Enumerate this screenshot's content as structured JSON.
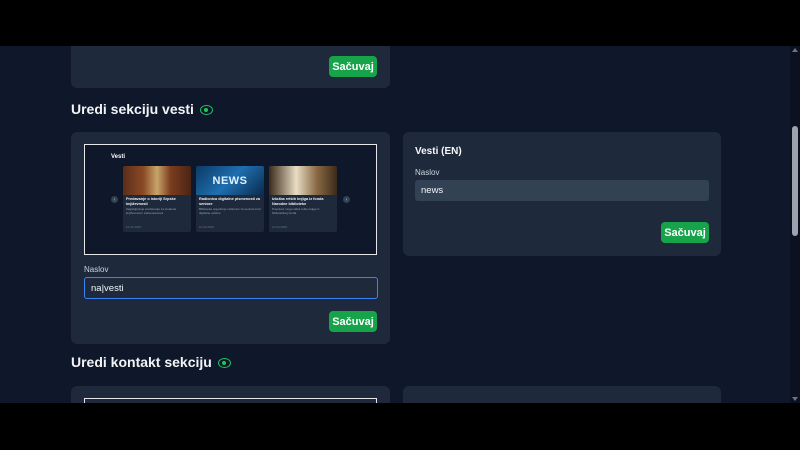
{
  "colors": {
    "background": "#0f172a",
    "card": "#1e293b",
    "accent": "#16a34a",
    "focus": "#3b82f6"
  },
  "top_section": {
    "save_label": "Sačuvaj"
  },
  "news_section": {
    "title": "Uredi sekciju vesti",
    "visibility_icon": "eye-icon",
    "preview": {
      "title": "Vesti",
      "prev_icon": "chevron-left-icon",
      "next_icon": "chevron-right-icon",
      "cards": [
        {
          "title": "Predavanje o istoriji Srpske književnosti",
          "desc": "Zaglavljivanje predavanja za studente književnosti i zainteresovani",
          "date": "10.02.2025"
        },
        {
          "title": "Radionica digitalne pismenosti za seniore",
          "desc": "Biblioteka organizuje radionice za seniore kroz digitalne veštine",
          "date": "10.02.2025"
        },
        {
          "title": "Izložba retkih knjiga iz fonda Narodne biblioteke",
          "desc": "Posetioci mogu videti retke knjige iz bibliotečkog fonda",
          "date": "10.02.2025"
        }
      ],
      "badge_text": "NEWS"
    },
    "field_label": "Naslov",
    "field_value": "na|vesti",
    "save_label": "Sačuvaj",
    "en_card": {
      "title": "Vesti (EN)",
      "field_label": "Naslov",
      "field_value": "news",
      "save_label": "Sačuvaj"
    }
  },
  "contact_section": {
    "title": "Uredi kontakt sekciju",
    "visibility_icon": "eye-icon"
  }
}
